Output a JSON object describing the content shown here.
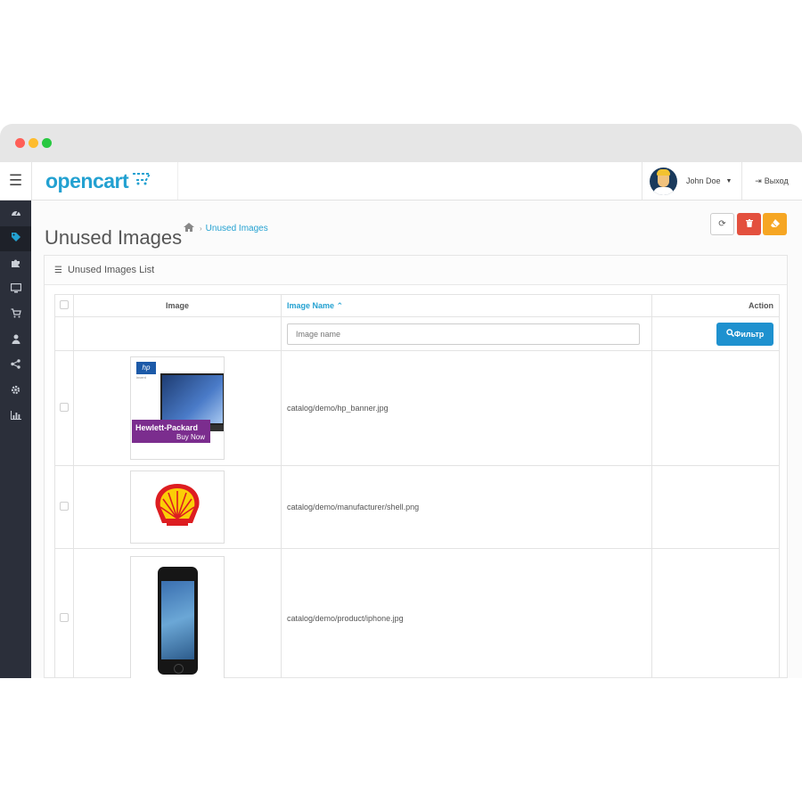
{
  "app": {
    "logo_text": "opencart",
    "user_name": "John Doe",
    "logout_label": "Выход"
  },
  "sidebar": {
    "items": [
      {
        "icon": "dashboard-icon",
        "active": false
      },
      {
        "icon": "tag-icon",
        "active": true
      },
      {
        "icon": "puzzle-icon",
        "active": false
      },
      {
        "icon": "monitor-icon",
        "active": false
      },
      {
        "icon": "cart-icon",
        "active": false
      },
      {
        "icon": "user-icon",
        "active": false
      },
      {
        "icon": "share-icon",
        "active": false
      },
      {
        "icon": "cog-icon",
        "active": false
      },
      {
        "icon": "bar-chart-icon",
        "active": false
      }
    ]
  },
  "page": {
    "title": "Unused Images",
    "breadcrumb": "Unused Images"
  },
  "panel": {
    "title": "Unused Images List"
  },
  "table": {
    "headers": {
      "image": "Image",
      "image_name": "Image Name",
      "action": "Action"
    },
    "filter_placeholder": "Image name",
    "filter_button": "Фильтр",
    "rows": [
      {
        "name": "catalog/demo/hp_banner.jpg",
        "thumb": "hp-banner",
        "banner_title": "Hewlett-Packard",
        "banner_cta": "Buy Now",
        "logo_text": "hp",
        "tagline": "invent"
      },
      {
        "name": "catalog/demo/manufacturer/shell.png",
        "thumb": "shell"
      },
      {
        "name": "catalog/demo/product/iphone.jpg",
        "thumb": "iphone"
      }
    ]
  },
  "colors": {
    "accent": "#23a1d1",
    "filter_button": "#1e91cf",
    "delete_button": "#e3503e",
    "clear_button": "#f6a623",
    "sidebar": "#2b2f3a"
  }
}
